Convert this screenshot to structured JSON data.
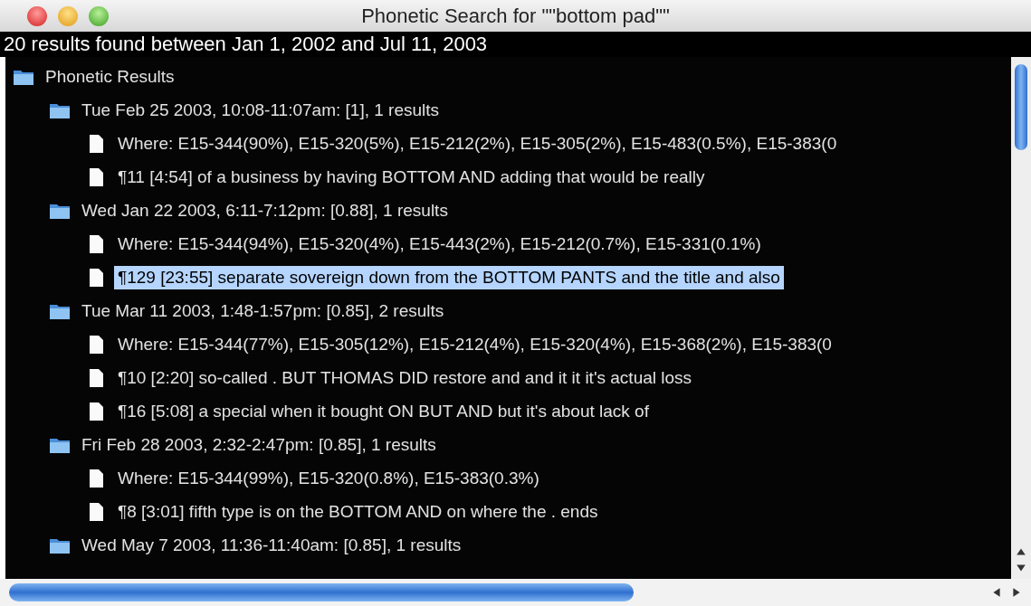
{
  "window": {
    "title": "Phonetic Search for \"\"bottom pad\"\""
  },
  "summary": "20 results found between Jan 1, 2002 and Jul 11, 2003",
  "tree": {
    "kind": "folder",
    "label": "Phonetic Results",
    "selected": false,
    "children": [
      {
        "kind": "folder",
        "label": "Tue Feb 25 2003, 10:08-11:07am: [1], 1 results",
        "selected": false,
        "children": [
          {
            "kind": "file",
            "label": "Where: E15-344(90%), E15-320(5%), E15-212(2%), E15-305(2%), E15-483(0.5%), E15-383(0",
            "selected": false
          },
          {
            "kind": "file",
            "label": "¶11 [4:54] of a business by having BOTTOM AND adding that would be really",
            "selected": false
          }
        ]
      },
      {
        "kind": "folder",
        "label": "Wed Jan 22 2003, 6:11-7:12pm: [0.88], 1 results",
        "selected": false,
        "children": [
          {
            "kind": "file",
            "label": "Where: E15-344(94%), E15-320(4%), E15-443(2%), E15-212(0.7%), E15-331(0.1%)",
            "selected": false
          },
          {
            "kind": "file",
            "label": "¶129 [23:55] separate sovereign down from the BOTTOM PANTS and the title and also",
            "selected": true
          }
        ]
      },
      {
        "kind": "folder",
        "label": "Tue Mar 11 2003, 1:48-1:57pm: [0.85], 2 results",
        "selected": false,
        "children": [
          {
            "kind": "file",
            "label": "Where: E15-344(77%), E15-305(12%), E15-212(4%), E15-320(4%), E15-368(2%), E15-383(0",
            "selected": false
          },
          {
            "kind": "file",
            "label": "¶10 [2:20] so-called . BUT THOMAS DID restore and and it it it's actual loss",
            "selected": false
          },
          {
            "kind": "file",
            "label": "¶16 [5:08] a special when it bought ON BUT AND but it's about lack of",
            "selected": false
          }
        ]
      },
      {
        "kind": "folder",
        "label": "Fri Feb 28 2003, 2:32-2:47pm: [0.85], 1 results",
        "selected": false,
        "children": [
          {
            "kind": "file",
            "label": "Where: E15-344(99%), E15-320(0.8%), E15-383(0.3%)",
            "selected": false
          },
          {
            "kind": "file",
            "label": "¶8 [3:01] fifth type is on the BOTTOM AND on where the . ends",
            "selected": false
          }
        ]
      },
      {
        "kind": "folder",
        "label": "Wed May 7 2003, 11:36-11:40am: [0.85], 1 results",
        "selected": false
      }
    ]
  }
}
